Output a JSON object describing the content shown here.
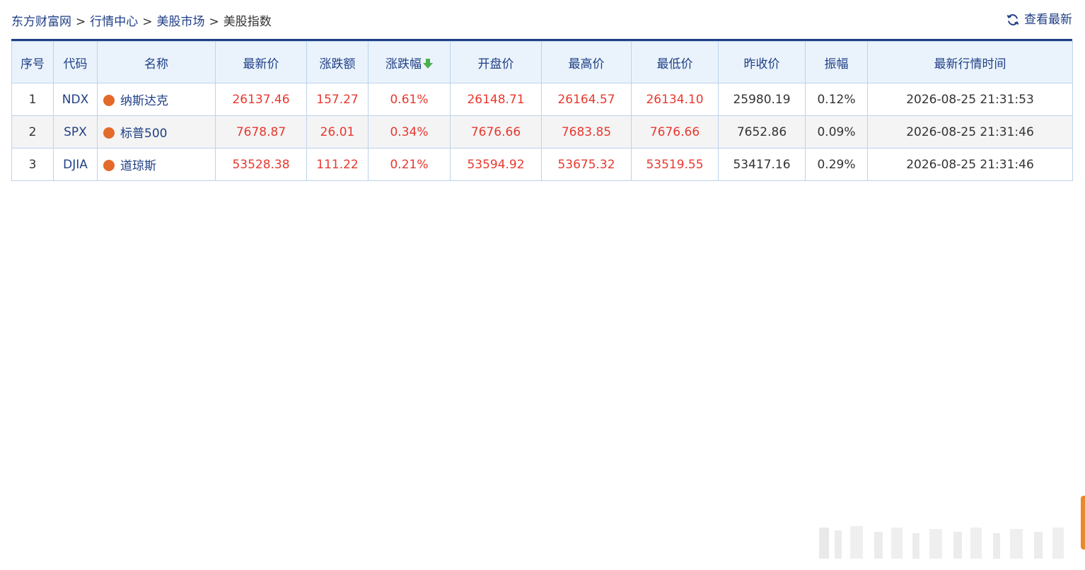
{
  "breadcrumb": {
    "items": [
      "东方财富网",
      "行情中心",
      "美股市场"
    ],
    "separator": ">",
    "current": "美股指数"
  },
  "refresh": {
    "label": "查看最新",
    "icon": "refresh-icon"
  },
  "table": {
    "headers": {
      "index": "序号",
      "code": "代码",
      "name": "名称",
      "latest": "最新价",
      "change": "涨跌额",
      "change_pct": "涨跌幅",
      "open": "开盘价",
      "high": "最高价",
      "low": "最低价",
      "prev_close": "昨收价",
      "amplitude": "振幅",
      "time": "最新行情时间"
    },
    "sort": {
      "column": "change_pct",
      "direction": "desc",
      "icon": "down-arrow-icon"
    },
    "rows": [
      {
        "index": "1",
        "code": "NDX",
        "name": "纳斯达克",
        "latest": "26137.46",
        "change": "157.27",
        "change_pct": "0.61%",
        "open": "26148.71",
        "high": "26164.57",
        "low": "26134.10",
        "prev_close": "25980.19",
        "amplitude": "0.12%",
        "time": "2026-08-25 21:31:53"
      },
      {
        "index": "2",
        "code": "SPX",
        "name": "标普500",
        "latest": "7678.87",
        "change": "26.01",
        "change_pct": "0.34%",
        "open": "7676.66",
        "high": "7683.85",
        "low": "7676.66",
        "prev_close": "7652.86",
        "amplitude": "0.09%",
        "time": "2026-08-25 21:31:46"
      },
      {
        "index": "3",
        "code": "DJIA",
        "name": "道琼斯",
        "latest": "53528.38",
        "change": "111.22",
        "change_pct": "0.21%",
        "open": "53594.92",
        "high": "53675.32",
        "low": "53519.55",
        "prev_close": "53417.16",
        "amplitude": "0.29%",
        "time": "2026-08-25 21:31:46"
      }
    ]
  },
  "colors": {
    "brand": "#1f3f86",
    "up": "#e8382f",
    "header_bg": "#eaf3fc",
    "border": "#bcd3ea",
    "dot": "#e36a2b",
    "sort_arrow": "#4caf50"
  }
}
